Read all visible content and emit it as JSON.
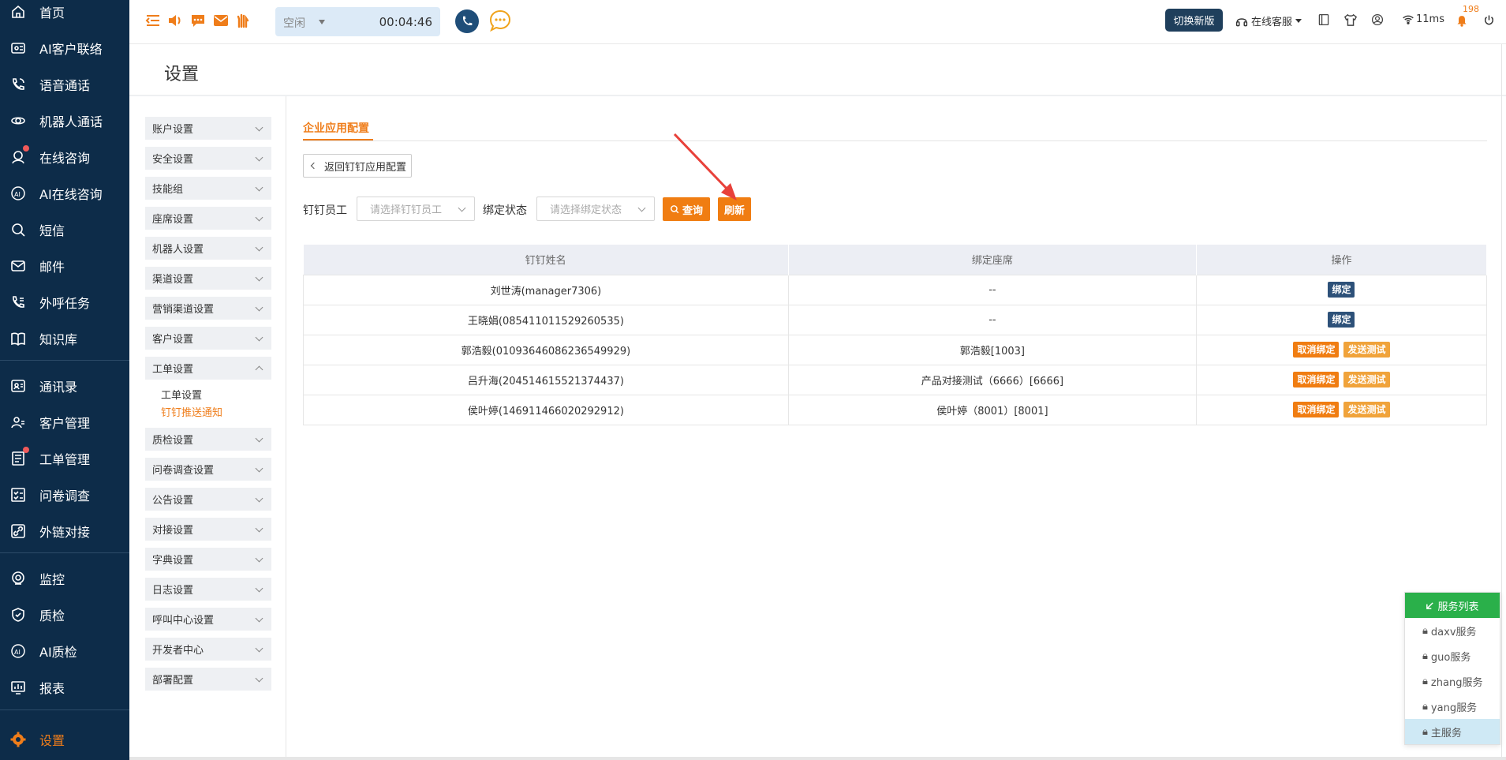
{
  "nav": {
    "items": [
      {
        "label": "首页",
        "icon": "home-icon"
      },
      {
        "label": "AI客户联络",
        "icon": "ai-contact-icon"
      },
      {
        "label": "语音通话",
        "icon": "phone-icon"
      },
      {
        "label": "机器人通话",
        "icon": "robot-icon"
      },
      {
        "label": "在线咨询",
        "icon": "online-chat-icon"
      },
      {
        "label": "AI在线咨询",
        "icon": "ai-chat-icon"
      },
      {
        "label": "短信",
        "icon": "sms-icon"
      },
      {
        "label": "邮件",
        "icon": "mail-icon"
      },
      {
        "label": "外呼任务",
        "icon": "outbound-icon"
      },
      {
        "label": "知识库",
        "icon": "book-icon"
      },
      {
        "label": "通讯录",
        "icon": "contacts-icon"
      },
      {
        "label": "客户管理",
        "icon": "customer-icon"
      },
      {
        "label": "工单管理",
        "icon": "ticket-icon"
      },
      {
        "label": "问卷调查",
        "icon": "survey-icon"
      },
      {
        "label": "外链对接",
        "icon": "link-icon"
      },
      {
        "label": "监控",
        "icon": "monitor-icon"
      },
      {
        "label": "质检",
        "icon": "quality-icon"
      },
      {
        "label": "AI质检",
        "icon": "ai-quality-icon"
      },
      {
        "label": "报表",
        "icon": "report-icon"
      },
      {
        "label": "设置",
        "icon": "gear-icon"
      }
    ]
  },
  "topbar": {
    "status": "空闲",
    "timer": "00:04:46",
    "new_version": "切换新版",
    "online_service": "在线客服",
    "latency": "11ms",
    "notifications": "198"
  },
  "page": {
    "title": "设置"
  },
  "settings_menu": {
    "items": [
      "账户设置",
      "安全设置",
      "技能组",
      "座席设置",
      "机器人设置",
      "渠道设置",
      "营销渠道设置",
      "客户设置",
      "工单设置",
      "质检设置",
      "问卷调查设置",
      "公告设置",
      "对接设置",
      "字典设置",
      "日志设置",
      "呼叫中心设置",
      "开发者中心",
      "部署配置"
    ],
    "sub_items": [
      "工单设置",
      "钉钉推送通知"
    ]
  },
  "content": {
    "tab": "企业应用配置",
    "back": "返回钉钉应用配置",
    "filter_employee_label": "钉钉员工",
    "filter_employee_placeholder": "请选择钉钉员工",
    "filter_status_label": "绑定状态",
    "filter_status_placeholder": "请选择绑定状态",
    "query": "查询",
    "refresh": "刷新"
  },
  "table": {
    "headers": [
      "钉钉姓名",
      "绑定座席",
      "操作"
    ],
    "rows": [
      {
        "name": "刘世涛(manager7306)",
        "seat": "--",
        "actions": [
          "绑定"
        ]
      },
      {
        "name": "王晓娟(085411011529260535)",
        "seat": "--",
        "actions": [
          "绑定"
        ]
      },
      {
        "name": "郭浩毅(01093646086236549929)",
        "seat": "郭浩毅[1003]",
        "actions": [
          "取消绑定",
          "发送测试"
        ]
      },
      {
        "name": "吕升海(204514615521374437)",
        "seat": "产品对接测试（6666）[6666]",
        "actions": [
          "取消绑定",
          "发送测试"
        ]
      },
      {
        "name": "侯叶婷(146911466020292912)",
        "seat": "侯叶婷（8001）[8001]",
        "actions": [
          "取消绑定",
          "发送测试"
        ]
      }
    ]
  },
  "service_list": {
    "title": "服务列表",
    "items": [
      "daxv服务",
      "guo服务",
      "zhang服务",
      "yang服务",
      "主服务"
    ]
  },
  "colors": {
    "accent": "#ef7d1a",
    "nav_bg": "#0d2c49",
    "bind": "#2d5179",
    "service_head": "#2ab04a"
  }
}
